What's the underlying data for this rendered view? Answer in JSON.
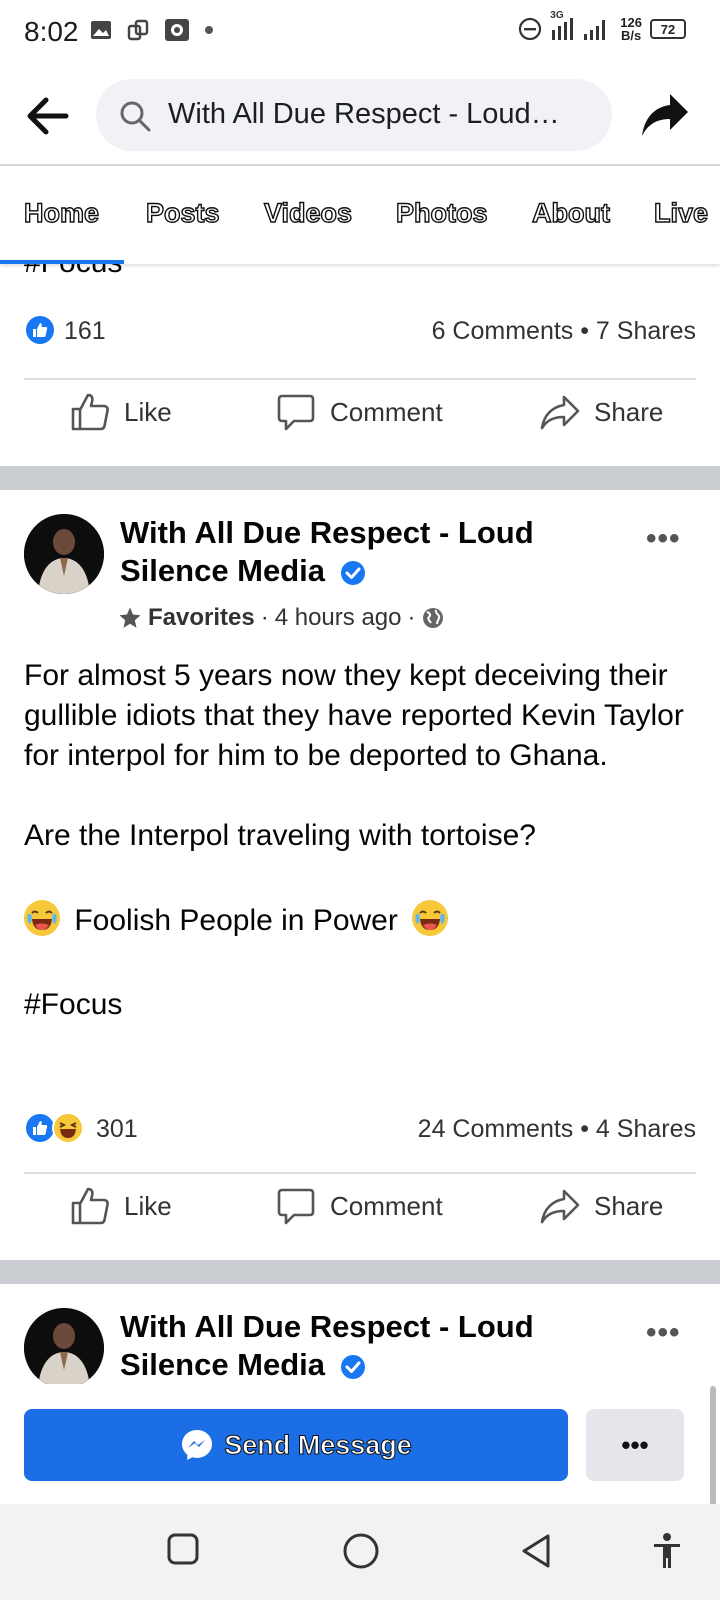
{
  "status_bar": {
    "time": "8:02",
    "network_label": "3G",
    "speed_value": "126",
    "speed_unit": "B/s",
    "battery": "72"
  },
  "search": {
    "query": "With All Due Respect - Loud…"
  },
  "tabs": [
    "Home",
    "Posts",
    "Videos",
    "Photos",
    "About",
    "Live"
  ],
  "previous_post": {
    "partial_text": "#Focus",
    "like_count": "161",
    "stats": "6 Comments • 7 Shares"
  },
  "actions": {
    "like": "Like",
    "comment": "Comment",
    "share": "Share"
  },
  "post": {
    "page_name": "With All Due Respect - Loud Silence Media",
    "favorites": "Favorites",
    "time": "4 hours ago",
    "paragraph1": "For almost 5 years now they kept deceiving their gullible idiots that they have reported Kevin Taylor for interpol for him to be deported to Ghana.",
    "paragraph2": "Are the Interpol traveling with tortoise?",
    "paragraph3": "Foolish People in Power",
    "hashtag": "#Focus",
    "reaction_count": "301",
    "stats": "24 Comments • 4 Shares"
  },
  "next_post": {
    "page_name": "With All Due Respect - Loud Silence Media"
  },
  "message_bar": {
    "send_label": "Send Message",
    "more_label": "•••"
  },
  "colors": {
    "facebook_blue": "#1877f2",
    "send_button": "#1b6ee5",
    "separator": "#c9ccd1"
  }
}
